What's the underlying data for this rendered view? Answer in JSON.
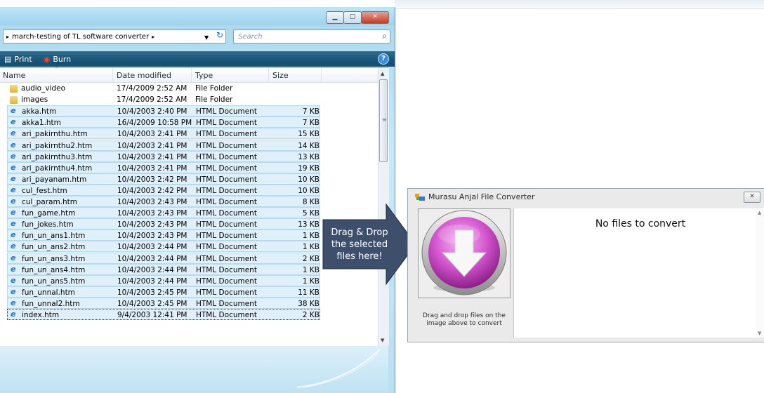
{
  "explorer": {
    "address": {
      "prefix_arrow": "▸",
      "path": "march-testing of TL software converter",
      "suffix_arrow": "▸",
      "search_placeholder": "Search"
    },
    "toolbar": {
      "print_label": "Print",
      "burn_label": "Burn"
    },
    "columns": {
      "name": "Name",
      "date": "Date modified",
      "type": "Type",
      "size": "Size"
    },
    "files": [
      {
        "name": "audio_video",
        "date": "17/4/2009 2:52 AM",
        "type": "File Folder",
        "size": "",
        "icon": "folder-icon",
        "selected": false
      },
      {
        "name": "images",
        "date": "17/4/2009 2:52 AM",
        "type": "File Folder",
        "size": "",
        "icon": "folder-icon",
        "selected": false
      },
      {
        "name": "akka.htm",
        "date": "10/4/2003 2:40 PM",
        "type": "HTML Document",
        "size": "7 KB",
        "icon": "ie-icon",
        "selected": true
      },
      {
        "name": "akka1.htm",
        "date": "16/4/2009 10:58 PM",
        "type": "HTML Document",
        "size": "7 KB",
        "icon": "ie-icon",
        "selected": true
      },
      {
        "name": "ari_pakirnthu.htm",
        "date": "10/4/2003 2:41 PM",
        "type": "HTML Document",
        "size": "15 KB",
        "icon": "ie-icon",
        "selected": true
      },
      {
        "name": "ari_pakirnthu2.htm",
        "date": "10/4/2003 2:41 PM",
        "type": "HTML Document",
        "size": "14 KB",
        "icon": "ie-icon",
        "selected": true
      },
      {
        "name": "ari_pakirnthu3.htm",
        "date": "10/4/2003 2:41 PM",
        "type": "HTML Document",
        "size": "13 KB",
        "icon": "ie-icon",
        "selected": true
      },
      {
        "name": "ari_pakirnthu4.htm",
        "date": "10/4/2003 2:41 PM",
        "type": "HTML Document",
        "size": "19 KB",
        "icon": "ie-icon",
        "selected": true
      },
      {
        "name": "ari_payanam.htm",
        "date": "10/4/2003 2:42 PM",
        "type": "HTML Document",
        "size": "10 KB",
        "icon": "ie-icon",
        "selected": true
      },
      {
        "name": "cul_fest.htm",
        "date": "10/4/2003 2:42 PM",
        "type": "HTML Document",
        "size": "10 KB",
        "icon": "ie-icon",
        "selected": true
      },
      {
        "name": "cul_param.htm",
        "date": "10/4/2003 2:43 PM",
        "type": "HTML Document",
        "size": "8 KB",
        "icon": "ie-icon",
        "selected": true
      },
      {
        "name": "fun_game.htm",
        "date": "10/4/2003 2:43 PM",
        "type": "HTML Document",
        "size": "5 KB",
        "icon": "ie-icon",
        "selected": true
      },
      {
        "name": "fun_jokes.htm",
        "date": "10/4/2003 2:43 PM",
        "type": "HTML Document",
        "size": "13 KB",
        "icon": "ie-icon",
        "selected": true
      },
      {
        "name": "fun_un_ans1.htm",
        "date": "10/4/2003 2:43 PM",
        "type": "HTML Document",
        "size": "1 KB",
        "icon": "ie-icon",
        "selected": true
      },
      {
        "name": "fun_un_ans2.htm",
        "date": "10/4/2003 2:44 PM",
        "type": "HTML Document",
        "size": "1 KB",
        "icon": "ie-icon",
        "selected": true
      },
      {
        "name": "fun_un_ans3.htm",
        "date": "10/4/2003 2:44 PM",
        "type": "HTML Document",
        "size": "2 KB",
        "icon": "ie-icon",
        "selected": true
      },
      {
        "name": "fun_un_ans4.htm",
        "date": "10/4/2003 2:44 PM",
        "type": "HTML Document",
        "size": "1 KB",
        "icon": "ie-icon",
        "selected": true
      },
      {
        "name": "fun_un_ans5.htm",
        "date": "10/4/2003 2:44 PM",
        "type": "HTML Document",
        "size": "1 KB",
        "icon": "ie-icon",
        "selected": true
      },
      {
        "name": "fun_unnal.htm",
        "date": "10/4/2003 2:45 PM",
        "type": "HTML Document",
        "size": "11 KB",
        "icon": "ie-icon",
        "selected": true
      },
      {
        "name": "fun_unnal2.htm",
        "date": "10/4/2003 2:45 PM",
        "type": "HTML Document",
        "size": "38 KB",
        "icon": "ie-icon",
        "selected": true
      },
      {
        "name": "index.htm",
        "date": "9/4/2003 12:41 PM",
        "type": "HTML Document",
        "size": "2 KB",
        "icon": "ie-icon",
        "selected": true
      }
    ]
  },
  "callout": {
    "line1": "Drag & Drop",
    "line2": "the selected",
    "line3": "files here!",
    "color": "#3d4f6b"
  },
  "converter": {
    "title": "Murasu Anjal File Converter",
    "close_label": "✕",
    "caption_line1": "Drag and drop files on the",
    "caption_line2": "image above to convert",
    "list_message": "No files to convert",
    "accent_color": "#cc44c8"
  }
}
